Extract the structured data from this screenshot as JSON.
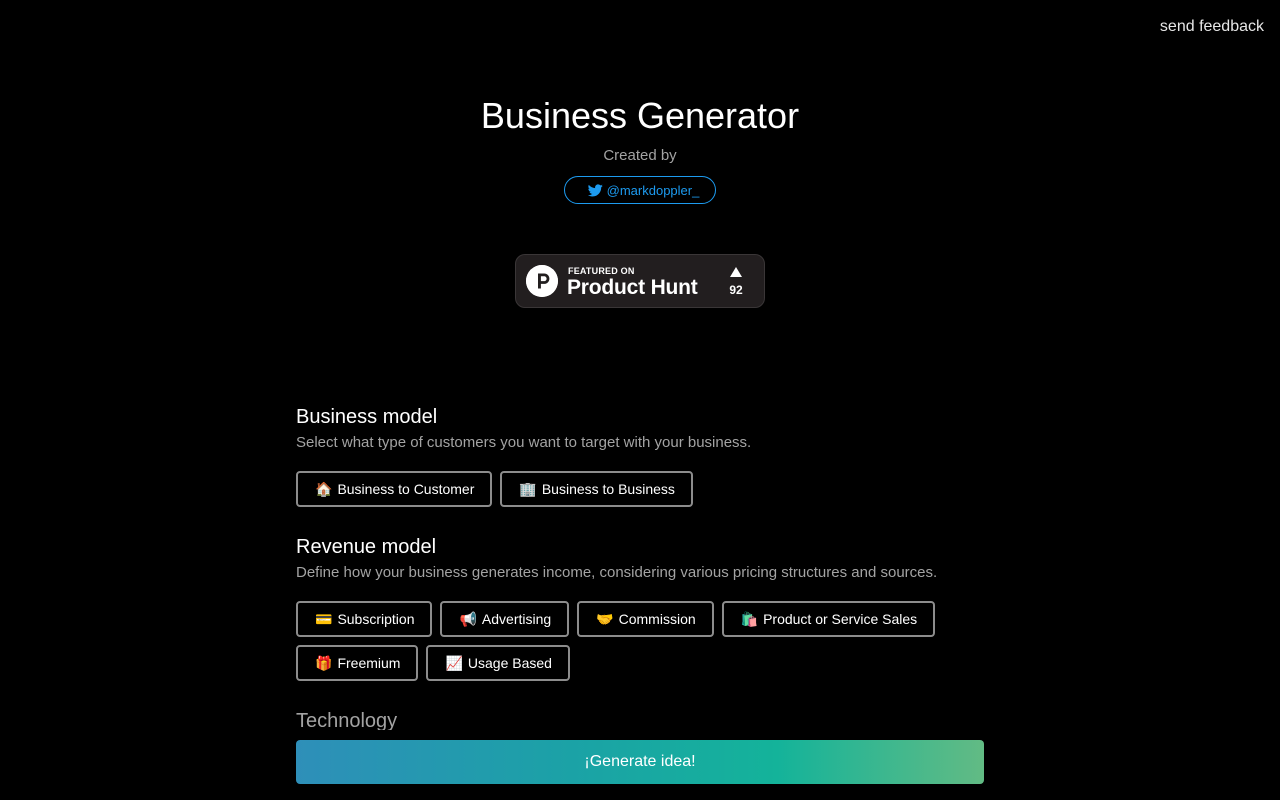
{
  "header": {
    "feedback_label": "send feedback"
  },
  "hero": {
    "title": "Business Generator",
    "created_by": "Created by",
    "twitter_handle": "@markdoppler_"
  },
  "product_hunt": {
    "kicker": "FEATURED ON",
    "name": "Product Hunt",
    "upvotes": "92"
  },
  "sections": {
    "business_model": {
      "title": "Business model",
      "description": "Select what type of customers you want to target with your business.",
      "options": [
        {
          "emoji": "🏠",
          "label": "Business to Customer"
        },
        {
          "emoji": "🏢",
          "label": "Business to Business"
        }
      ]
    },
    "revenue_model": {
      "title": "Revenue model",
      "description": "Define how your business generates income, considering various pricing structures and sources.",
      "options": [
        {
          "emoji": "💳",
          "label": "Subscription"
        },
        {
          "emoji": "📢",
          "label": "Advertising"
        },
        {
          "emoji": "🤝",
          "label": "Commission"
        },
        {
          "emoji": "🛍️",
          "label": "Product or Service Sales"
        },
        {
          "emoji": "🎁",
          "label": "Freemium"
        },
        {
          "emoji": "📈",
          "label": "Usage Based"
        }
      ]
    },
    "technology": {
      "title": "Technology"
    }
  },
  "actions": {
    "generate_label": "¡Generate idea!"
  },
  "colors": {
    "background": "#000000",
    "twitter_blue": "#1d9bf0",
    "muted_text": "#a3a3a3",
    "chip_border": "#8c8c8c",
    "ph_badge_bg": "#221e1f",
    "gradient_start": "#2e8fb9",
    "gradient_end": "#62bb84"
  },
  "icons": {
    "twitter": "twitter-bird-icon",
    "product_hunt": "product-hunt-logo-icon",
    "upvote": "upvote-triangle-icon"
  }
}
